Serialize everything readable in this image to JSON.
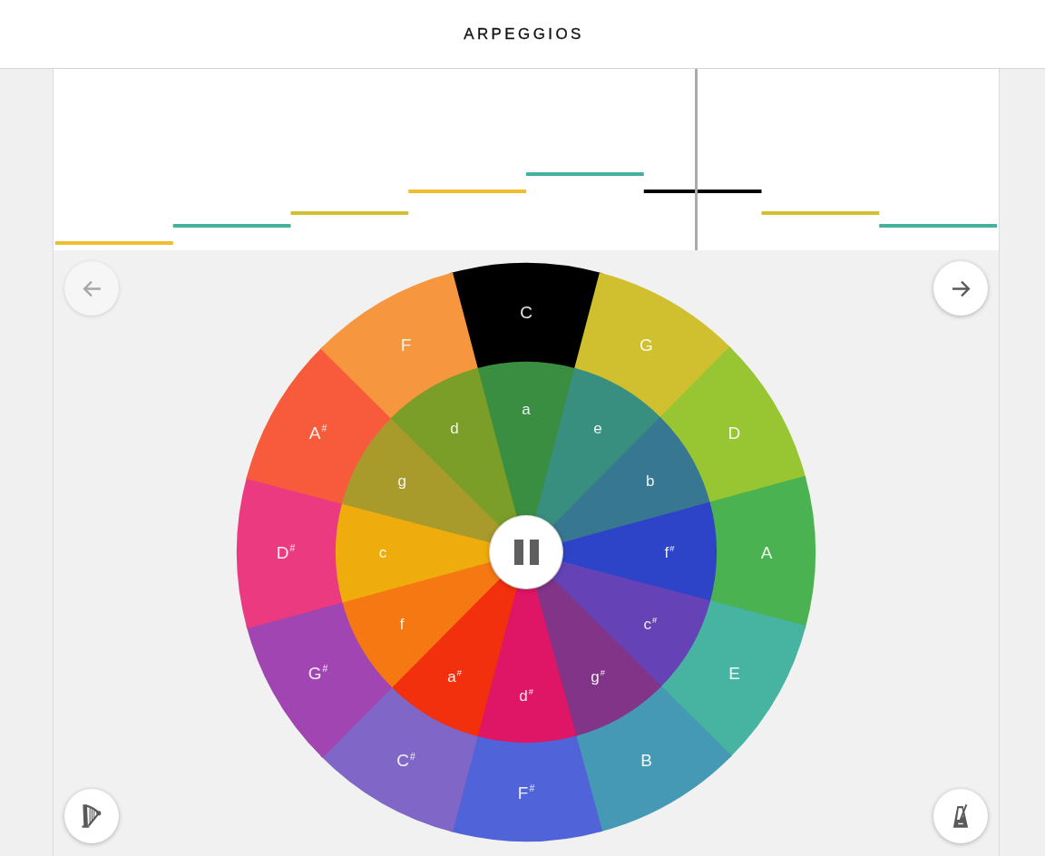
{
  "header": {
    "title": "ARPEGGIOS"
  },
  "note_roll": {
    "notes": [
      {
        "color": "#f1bc30",
        "active": false
      },
      {
        "color": "#45b09e",
        "active": false
      },
      {
        "color": "#d2bf32",
        "active": false
      },
      {
        "color": "#f1bc30",
        "active": false
      },
      {
        "color": "#45b09e",
        "active": false
      },
      {
        "active": true
      },
      {
        "color": "#d2bf32",
        "active": false
      },
      {
        "color": "#45b09e",
        "active": false
      }
    ],
    "playhead": {
      "level": 0.68
    }
  },
  "controls": {
    "previous": {
      "disabled": true
    },
    "next": {
      "disabled": false
    }
  },
  "playback": {
    "playing": true
  },
  "wheel": {
    "major_chords": [
      {
        "label": "C",
        "selected": true
      },
      {
        "label": "G",
        "color": "#d0c02f",
        "selected": false
      },
      {
        "label": "D",
        "color": "#98c532",
        "selected": false
      },
      {
        "label": "A",
        "color": "#4ab250",
        "selected": false
      },
      {
        "label": "E",
        "color": "#46b4a0",
        "selected": false
      },
      {
        "label": "B",
        "color": "#4699b5",
        "selected": false
      },
      {
        "label": "F$^{#}$",
        "color": "#5063d8",
        "selected": false
      },
      {
        "label": "C$^{#}$",
        "color": "#8066c6",
        "selected": false
      },
      {
        "label": "G$^{#}$",
        "color": "#a145b2",
        "selected": false
      },
      {
        "label": "D$^{#}$",
        "color": "#ec3a81",
        "selected": false
      },
      {
        "label": "A$^{#}$",
        "color": "#f75b3b",
        "selected": false
      },
      {
        "label": "F",
        "color": "#f6963e",
        "selected": false
      }
    ],
    "minor_chords": [
      {
        "label": "a",
        "color": "#3a8e42",
        "selected": false
      },
      {
        "label": "e",
        "color": "#388f80",
        "selected": false
      },
      {
        "label": "b",
        "color": "#387791",
        "selected": false
      },
      {
        "label": "f$^{#}$",
        "color": "#2e44c8",
        "selected": false
      },
      {
        "label": "c$^{#}$",
        "color": "#6543b6",
        "selected": false
      },
      {
        "label": "g$^{#}$",
        "color": "#813488",
        "selected": false
      },
      {
        "label": "d$^{#}$",
        "color": "#df1565",
        "selected": false
      },
      {
        "label": "a$^{#}$",
        "color": "#f2300e",
        "selected": false
      },
      {
        "label": "f",
        "color": "#f57812",
        "selected": false
      },
      {
        "label": "c",
        "color": "#efad0d",
        "selected": false
      },
      {
        "label": "g",
        "color": "#a89a2b",
        "selected": false
      },
      {
        "label": "d",
        "color": "#7a9e28",
        "selected": false
      }
    ]
  }
}
